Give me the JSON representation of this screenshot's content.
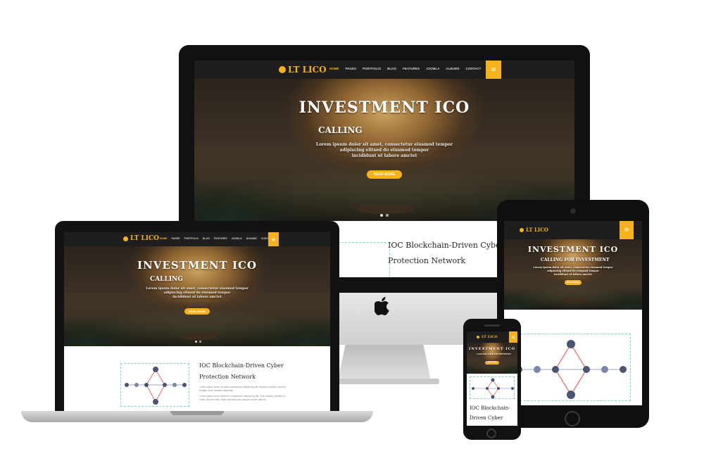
{
  "site": {
    "logo": "LT LICO",
    "menu": [
      "HOME",
      "PAGES",
      "PORTFOLIO",
      "BLOG",
      "FEATURES",
      "JOOMLA",
      "ALBUMS",
      "CONTACT"
    ],
    "burger_icon": "menu-icon"
  },
  "hero": {
    "title": "INVESTMENT ICO",
    "subtitle": "CALLING",
    "subtitle_tablet": "CALLING FOR INVESTMENT",
    "text_line1": "Lorem ipsum dolor sit amet, consectetur eiusmod tempor",
    "text_line2": "adipiscing elitsed do eiusmod tempor",
    "text_line3": "incididunt ut labore amctet",
    "button": "READ MORE"
  },
  "content": {
    "title_line1": "IOC Blockchain-Driven Cyber",
    "title_line2": "Protection Network",
    "phone_title_line1": "IOC Blockchain-",
    "phone_title_line2": "Driven Cyber",
    "paragraph1": "Lorem ipsum dolor sit amet consectetur adipiscing elit. Aliquam pretium sed leo, fringilla dolor sodales dignissim.",
    "paragraph2": "Lorem ipsum dolor sit amet, consectetur adipiscing elit. Duis mauris, porttitor ut porta. Aenean felis. Nulla elit tellus non aliquet ornare ultrices."
  },
  "colors": {
    "accent": "#f5b21b",
    "nav_bg": "#1e1e1e",
    "diagram_border": "#7fd3c5",
    "diagram_line": "#e46b6b"
  },
  "icons": {
    "apple_logo": "apple-logo-icon",
    "coin_logo": "coin-icon"
  }
}
